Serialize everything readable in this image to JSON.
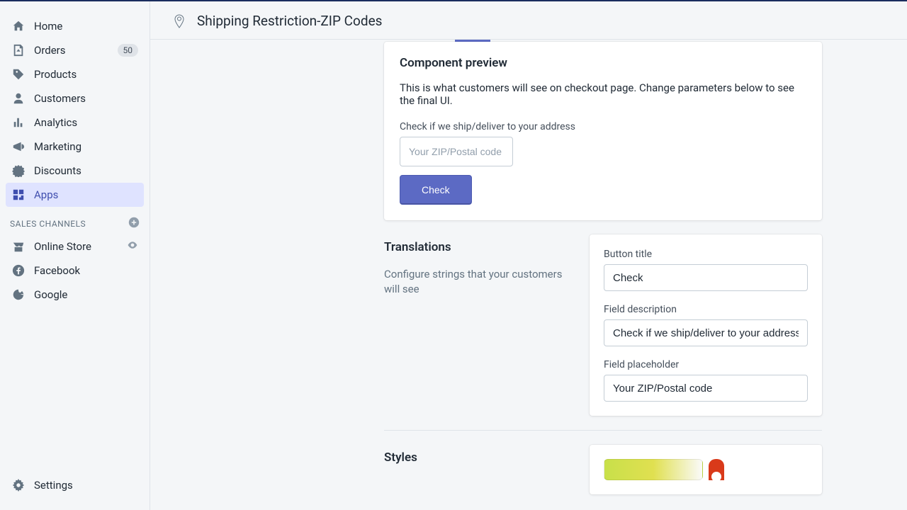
{
  "header": {
    "title": "Shipping Restriction-ZIP Codes"
  },
  "sidebar": {
    "items": [
      {
        "label": "Home"
      },
      {
        "label": "Orders",
        "badge": "50"
      },
      {
        "label": "Products"
      },
      {
        "label": "Customers"
      },
      {
        "label": "Analytics"
      },
      {
        "label": "Marketing"
      },
      {
        "label": "Discounts"
      },
      {
        "label": "Apps"
      }
    ],
    "section_label": "SALES CHANNELS",
    "channels": [
      {
        "label": "Online Store"
      },
      {
        "label": "Facebook"
      },
      {
        "label": "Google"
      }
    ],
    "settings_label": "Settings"
  },
  "preview": {
    "title": "Component preview",
    "description": "This is what customers will see on checkout page. Change parameters below to see the final UI.",
    "field_label": "Check if we ship/deliver to your address",
    "placeholder": "Your ZIP/Postal code",
    "button_label": "Check"
  },
  "translations": {
    "heading": "Translations",
    "subtext": "Configure strings that your customers will see",
    "button_title_label": "Button title",
    "button_title_value": "Check",
    "field_desc_label": "Field description",
    "field_desc_value": "Check if we ship/deliver to your address",
    "field_placeholder_label": "Field placeholder",
    "field_placeholder_value": "Your ZIP/Postal code"
  },
  "styles": {
    "heading": "Styles"
  }
}
